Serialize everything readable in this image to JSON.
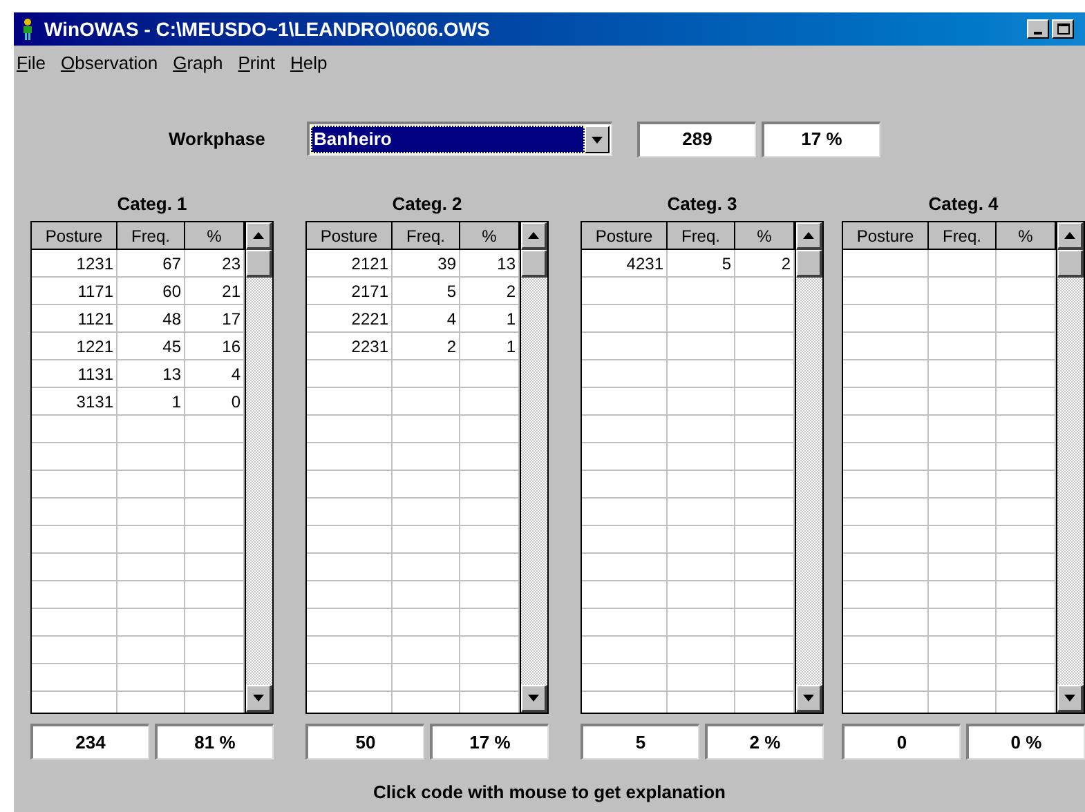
{
  "window": {
    "title": "WinOWAS - C:\\MEUSDO~1\\LEANDRO\\0606.OWS"
  },
  "menu": [
    "File",
    "Observation",
    "Graph",
    "Print",
    "Help"
  ],
  "workphase": {
    "label": "Workphase",
    "value": "Banheiro",
    "count": "289",
    "percent": "17 %"
  },
  "categories": [
    {
      "title": "Categ. 1",
      "columns": [
        "Posture",
        "Freq.",
        "%"
      ],
      "rows": [
        [
          "1231",
          "67",
          "23"
        ],
        [
          "1171",
          "60",
          "21"
        ],
        [
          "1121",
          "48",
          "17"
        ],
        [
          "1221",
          "45",
          "16"
        ],
        [
          "1131",
          "13",
          "4"
        ],
        [
          "3131",
          "1",
          "0"
        ]
      ],
      "total": "234",
      "percent": "81 %"
    },
    {
      "title": "Categ. 2",
      "columns": [
        "Posture",
        "Freq.",
        "%"
      ],
      "rows": [
        [
          "2121",
          "39",
          "13"
        ],
        [
          "2171",
          "5",
          "2"
        ],
        [
          "2221",
          "4",
          "1"
        ],
        [
          "2231",
          "2",
          "1"
        ]
      ],
      "total": "50",
      "percent": "17 %"
    },
    {
      "title": "Categ. 3",
      "columns": [
        "Posture",
        "Freq.",
        "%"
      ],
      "rows": [
        [
          "4231",
          "5",
          "2"
        ]
      ],
      "total": "5",
      "percent": "2 %"
    },
    {
      "title": "Categ. 4",
      "columns": [
        "Posture",
        "Freq.",
        "%"
      ],
      "total": "0",
      "percent": "0 %"
    }
  ],
  "status": "Click code with mouse to get explanation"
}
